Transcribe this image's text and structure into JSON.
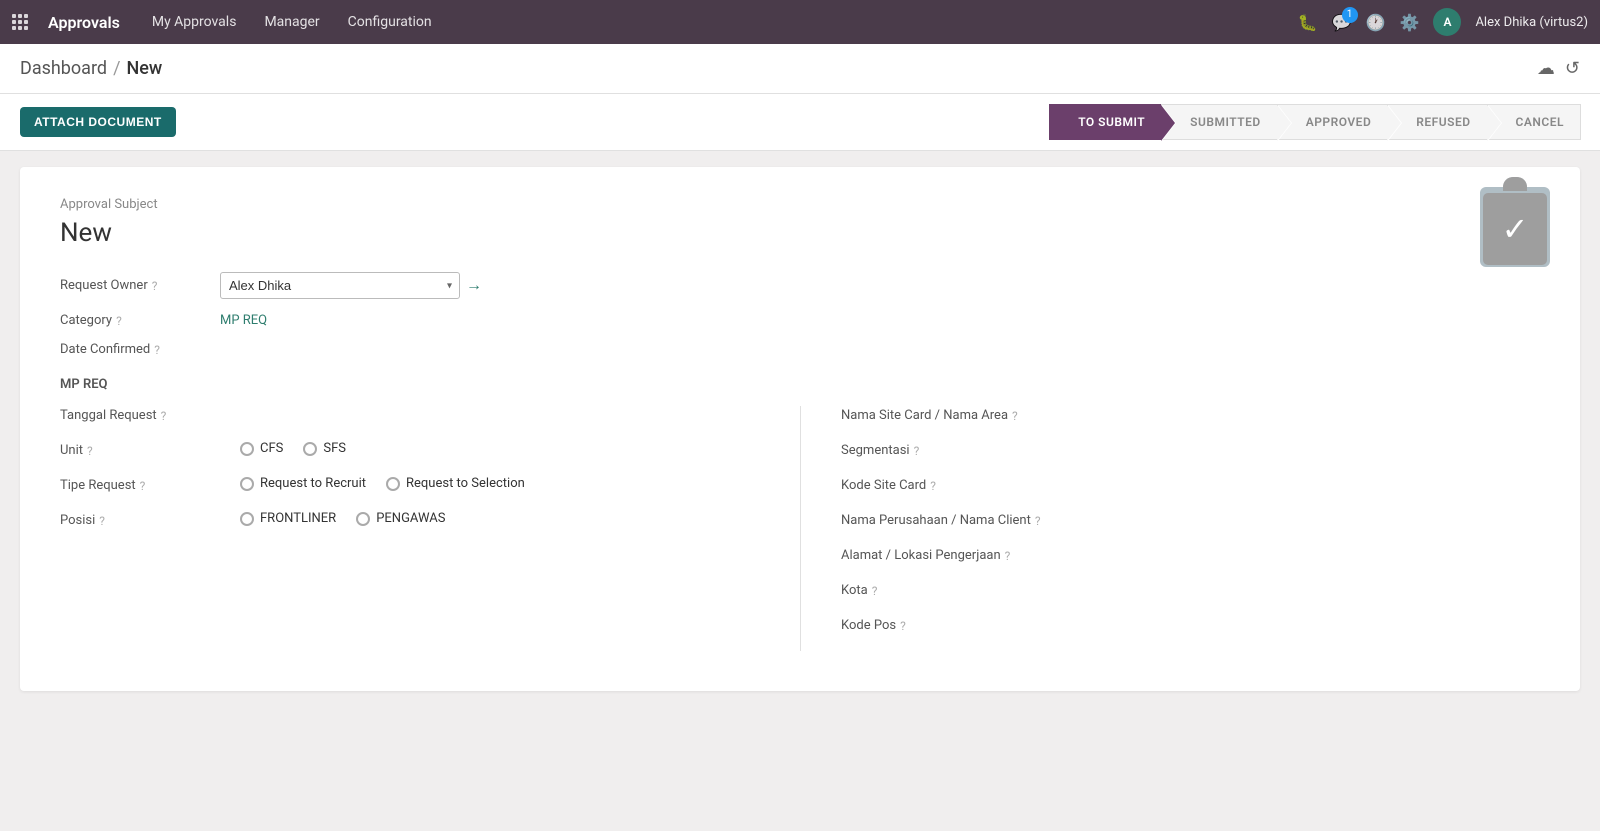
{
  "navbar": {
    "brand": "Approvals",
    "menu": [
      "My Approvals",
      "Manager",
      "Configuration"
    ],
    "user": {
      "initials": "A",
      "name": "Alex Dhika (virtus2)"
    },
    "notification_count": "1"
  },
  "breadcrumb": {
    "parent": "Dashboard",
    "separator": "/",
    "current": "New"
  },
  "toolbar": {
    "attach_label": "ATTACH DOCUMENT"
  },
  "pipeline": {
    "steps": [
      "TO SUBMIT",
      "SUBMITTED",
      "APPROVED",
      "REFUSED",
      "CANCEL"
    ]
  },
  "form": {
    "approval_subject_label": "Approval Subject",
    "title": "New",
    "fields": {
      "request_owner": {
        "label": "Request Owner",
        "value": "Alex Dhika"
      },
      "category": {
        "label": "Category",
        "value": "MP REQ"
      },
      "date_confirmed": {
        "label": "Date Confirmed"
      }
    },
    "section_label": "MP REQ",
    "left": {
      "tanggal_request": {
        "label": "Tanggal Request"
      },
      "unit": {
        "label": "Unit",
        "options": [
          "CFS",
          "SFS"
        ]
      },
      "tipe_request": {
        "label": "Tipe Request",
        "options": [
          "Request to Recruit",
          "Request to Selection"
        ]
      },
      "posisi": {
        "label": "Posisi",
        "options": [
          "FRONTLINER",
          "PENGAWAS"
        ]
      }
    },
    "right": {
      "nama_site": {
        "label": "Nama Site Card / Nama Area"
      },
      "segmentasi": {
        "label": "Segmentasi"
      },
      "kode_site": {
        "label": "Kode Site Card"
      },
      "nama_perusahaan": {
        "label": "Nama Perusahaan / Nama Client"
      },
      "alamat": {
        "label": "Alamat / Lokasi Pengerjaan"
      },
      "kota": {
        "label": "Kota"
      },
      "kode_pos": {
        "label": "Kode Pos"
      }
    }
  }
}
